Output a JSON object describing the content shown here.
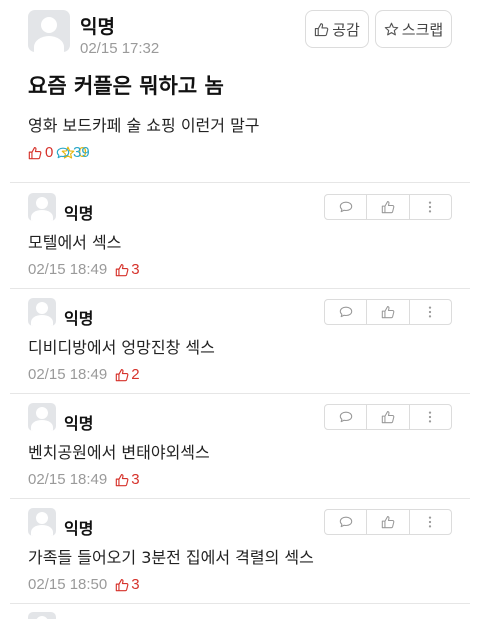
{
  "post": {
    "author": "익명",
    "date": "02/15 17:32",
    "like_button": "공감",
    "scrap_button": "스크랩",
    "title": "요즘 커플은 뭐하고 놈",
    "body": "영화 보드카페 술 쇼핑 이런거 말구",
    "likes": "0",
    "comments": "39",
    "scraps": "0"
  },
  "comments": [
    {
      "author": "익명",
      "text": "모텔에서 섹스",
      "time": "02/15 18:49",
      "likes": "3"
    },
    {
      "author": "익명",
      "text": "디비디방에서 엉망진창 섹스",
      "time": "02/15 18:49",
      "likes": "2"
    },
    {
      "author": "익명",
      "text": "벤치공원에서 변태야외섹스",
      "time": "02/15 18:49",
      "likes": "3"
    },
    {
      "author": "익명",
      "text": "가족들 들어오기 3분전 집에서 격렬의 섹스",
      "time": "02/15 18:50",
      "likes": "3"
    }
  ],
  "colors": {
    "like": "#d6322b",
    "comment": "#2aa7c8",
    "scrap": "#e8b80f",
    "muted": "#9a9a9a"
  },
  "icons": {
    "like": "thumbs-up-icon",
    "comment": "speech-bubble-icon",
    "scrap": "star-icon",
    "more": "more-vertical-icon",
    "avatar": "default-avatar-icon"
  }
}
